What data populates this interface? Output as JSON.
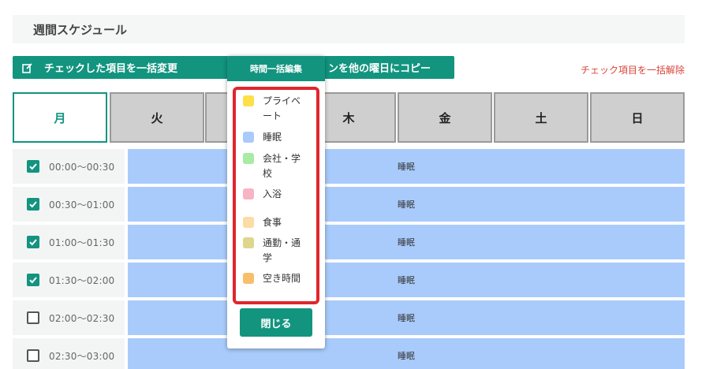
{
  "header": {
    "title": "週間スケジュール"
  },
  "toolbar": {
    "bulk_change_label": "チェックした項目を一括変更",
    "copy_label": "ンを他の曜日にコピー",
    "clear_label": "チェック項目を一括解除"
  },
  "days": [
    {
      "label": "月",
      "active": true
    },
    {
      "label": "火",
      "active": false
    },
    {
      "label": "",
      "active": false
    },
    {
      "label": "木",
      "active": false
    },
    {
      "label": "金",
      "active": false
    },
    {
      "label": "土",
      "active": false
    },
    {
      "label": "日",
      "active": false
    }
  ],
  "rows": [
    {
      "time": "00:00〜00:30",
      "checked": true,
      "activity": "睡眠"
    },
    {
      "time": "00:30〜01:00",
      "checked": true,
      "activity": "睡眠"
    },
    {
      "time": "01:00〜01:30",
      "checked": true,
      "activity": "睡眠"
    },
    {
      "time": "01:30〜02:00",
      "checked": true,
      "activity": "睡眠"
    },
    {
      "time": "02:00〜02:30",
      "checked": false,
      "activity": "睡眠"
    },
    {
      "time": "02:30〜03:00",
      "checked": false,
      "activity": "睡眠"
    }
  ],
  "popup": {
    "title": "時間一括編集",
    "close_label": "閉じる",
    "categories": [
      {
        "label": "プライベート",
        "color": "#fde047"
      },
      {
        "label": "睡眠",
        "color": "#a9cbfb"
      },
      {
        "label": "会社・学校",
        "color": "#a7eba5"
      },
      {
        "label": "入浴",
        "color": "#f8b4c4"
      },
      {
        "label": "食事",
        "color": "#fbdca4"
      },
      {
        "label": "通勤・通学",
        "color": "#ddd68c"
      },
      {
        "label": "空き時間",
        "color": "#f8bf6a"
      }
    ]
  },
  "colors": {
    "accent": "#12947f",
    "danger": "#d9443b",
    "block": "#a9cbfb",
    "highlight": "#e0262c"
  }
}
